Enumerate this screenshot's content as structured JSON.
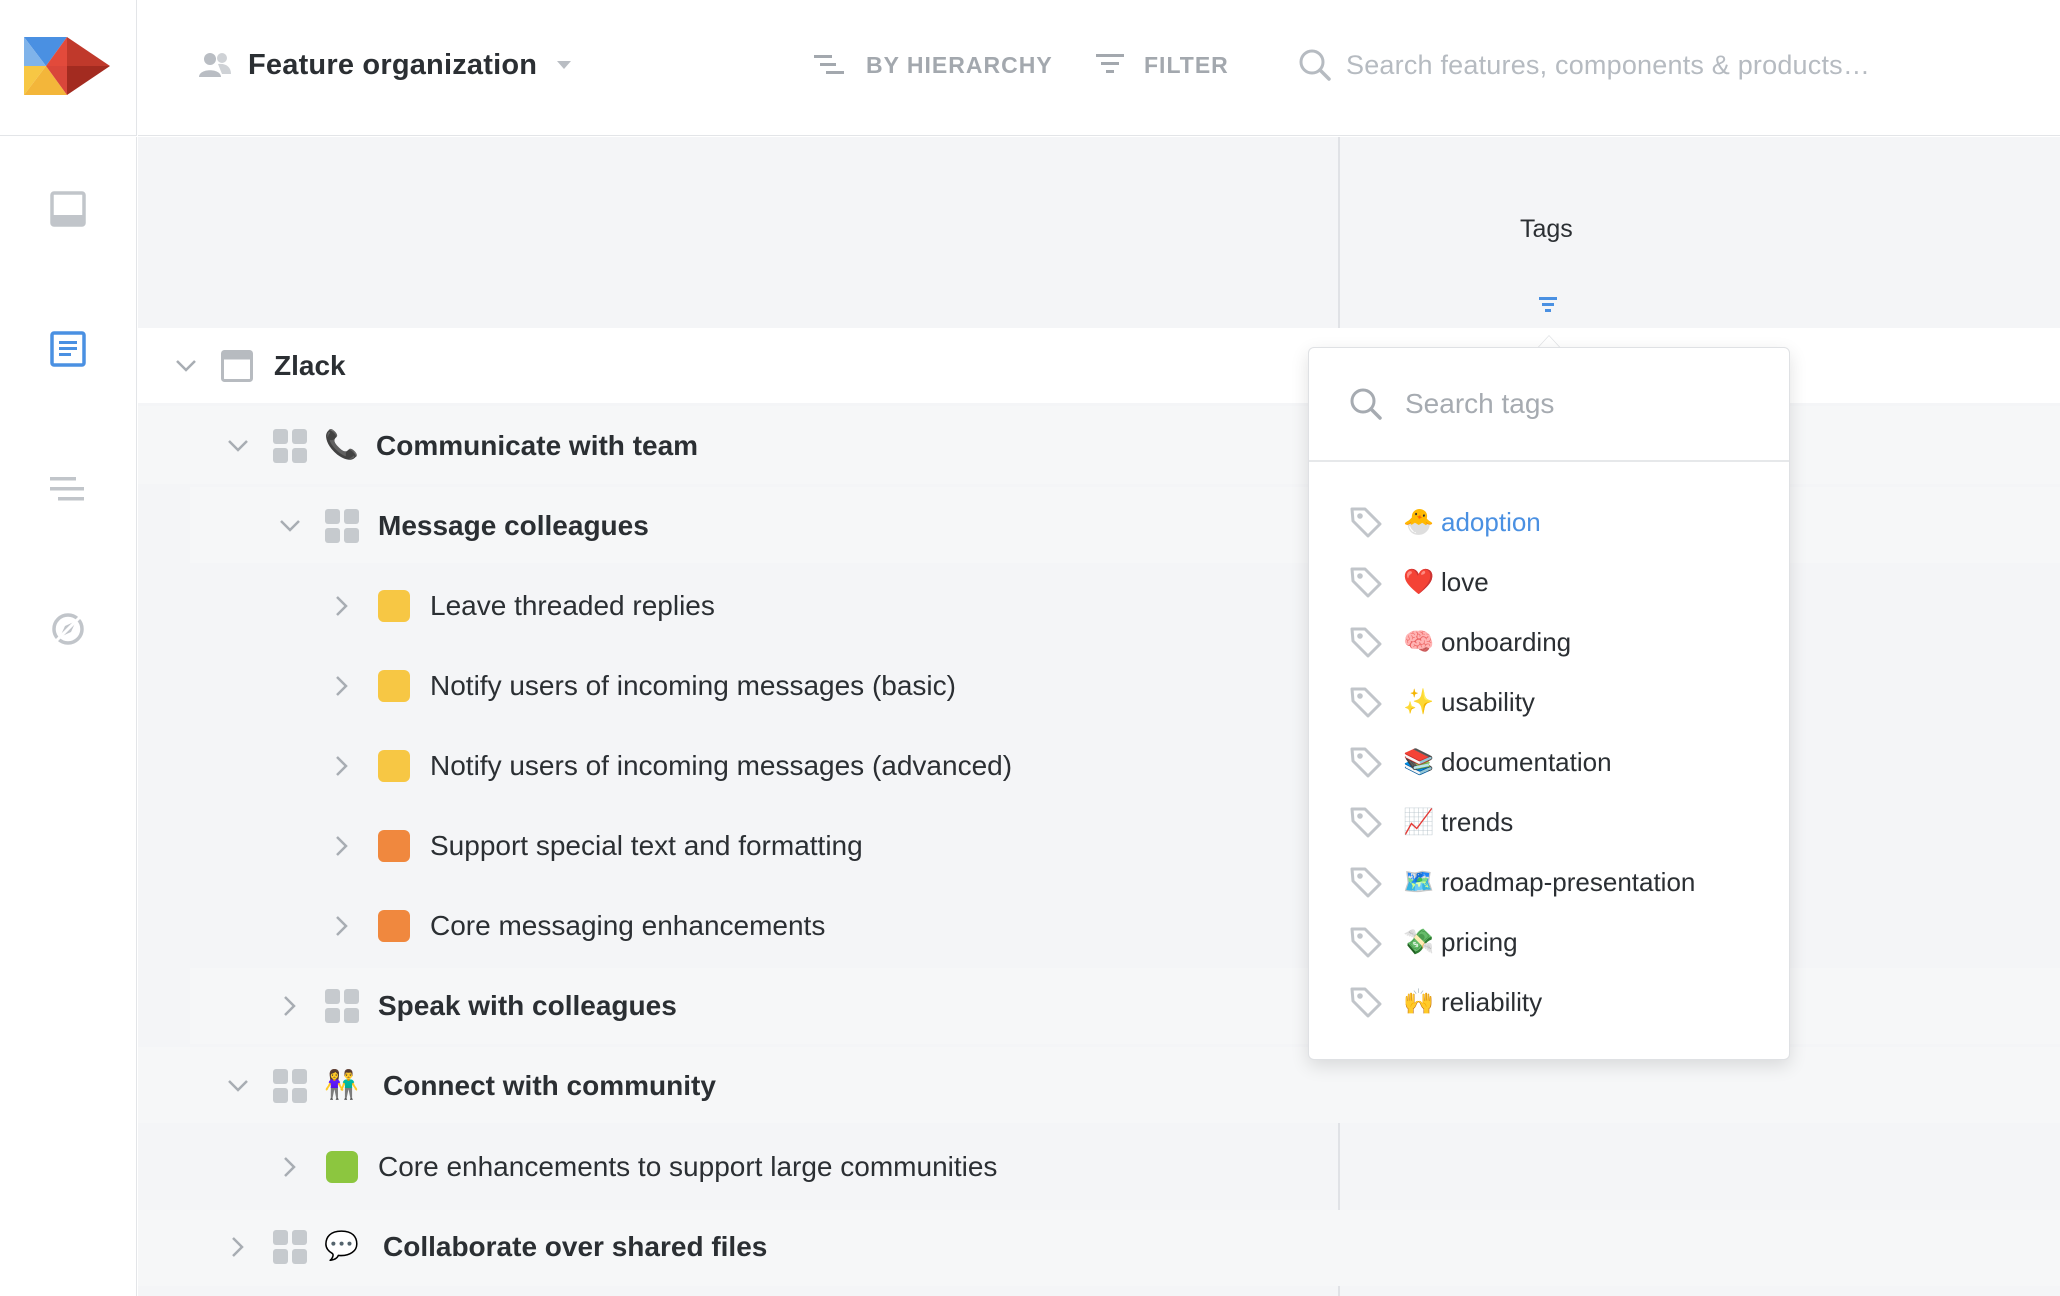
{
  "topbar": {
    "view_title": "Feature organization",
    "hierarchy_label": "BY HIERARCHY",
    "filter_label": "FILTER",
    "search_placeholder": "Search features, components & products…"
  },
  "column": {
    "tags_header": "Tags"
  },
  "tree": {
    "product": "Zlack",
    "comp_communicate": "Communicate with team",
    "comp_message": "Message colleagues",
    "feat_threaded": "Leave threaded replies",
    "feat_notify_basic": "Notify users of incoming messages (basic)",
    "feat_notify_adv": "Notify users of incoming messages (advanced)",
    "feat_special_text": "Support special text and formatting",
    "feat_core_msg": "Core messaging enhancements",
    "comp_speak": "Speak with colleagues",
    "comp_community": "Connect with community",
    "feat_core_community": "Core enhancements to support large communities",
    "comp_collaborate": "Collaborate over shared files"
  },
  "status_colors": {
    "yellow": "#f7c744",
    "orange": "#f0883e",
    "green": "#8cc63f"
  },
  "icons": {
    "communicate": "📞",
    "community": "👫",
    "collaborate": "💬"
  },
  "tag_dropdown": {
    "search_placeholder": "Search tags",
    "tags": [
      {
        "emoji": "🐣",
        "name": "adoption",
        "active": true
      },
      {
        "emoji": "❤️",
        "name": "love"
      },
      {
        "emoji": "🧠",
        "name": "onboarding"
      },
      {
        "emoji": "✨",
        "name": "usability"
      },
      {
        "emoji": "📚",
        "name": "documentation"
      },
      {
        "emoji": "📈",
        "name": "trends"
      },
      {
        "emoji": "🗺️",
        "name": "roadmap-presentation"
      },
      {
        "emoji": "💸",
        "name": "pricing"
      },
      {
        "emoji": "🙌",
        "name": "reliability"
      }
    ]
  },
  "colors": {
    "accent": "#4a90e2",
    "logo_red": "#d0392b",
    "logo_blue": "#4a90e2",
    "logo_yellow": "#f7c744"
  }
}
